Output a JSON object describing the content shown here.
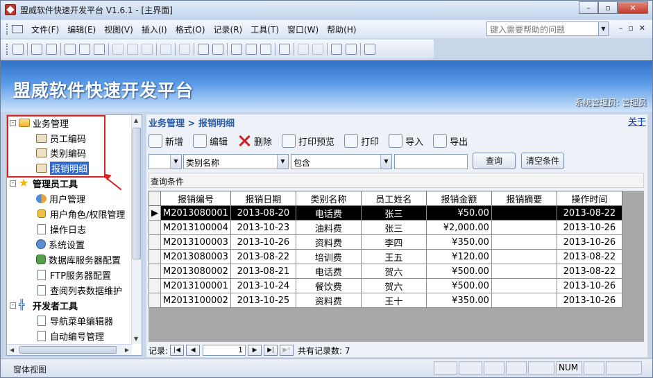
{
  "window": {
    "title": "盟威软件快速开发平台 V1.6.1 - [主界面]",
    "buttons": [
      "–",
      "▫",
      "✕"
    ]
  },
  "menu": {
    "items": [
      "文件(F)",
      "编辑(E)",
      "视图(V)",
      "插入(I)",
      "格式(O)",
      "记录(R)",
      "工具(T)",
      "窗口(W)",
      "帮助(H)"
    ],
    "help_placeholder": "键入需要帮助的问题",
    "mdi_buttons": [
      "–",
      "▫",
      "✕"
    ]
  },
  "banner": {
    "title": "盟威软件快速开发平台",
    "user": "系统管理员: 管理员"
  },
  "tree": {
    "items": [
      {
        "label": "业务管理",
        "expander": "-",
        "icon": "folder"
      },
      {
        "label": "员工编码",
        "icon": "leaf"
      },
      {
        "label": "类别编码",
        "icon": "leaf"
      },
      {
        "label": "报销明细",
        "icon": "leaf",
        "selected": true
      },
      {
        "label": "管理员工具",
        "expander": "-",
        "icon": "star"
      },
      {
        "label": "用户管理",
        "icon": "users"
      },
      {
        "label": "用户角色/权限管理",
        "icon": "lock"
      },
      {
        "label": "操作日志",
        "icon": "doc"
      },
      {
        "label": "系统设置",
        "icon": "gear"
      },
      {
        "label": "数据库服务器配置",
        "icon": "db"
      },
      {
        "label": "FTP服务器配置",
        "icon": "doc"
      },
      {
        "label": "查阅列表数据维护",
        "icon": "doc"
      },
      {
        "label": "开发者工具",
        "expander": "-",
        "icon": "tools"
      },
      {
        "label": "导航菜单编辑器",
        "icon": "doc"
      },
      {
        "label": "自动编号管理",
        "icon": "doc"
      }
    ]
  },
  "main": {
    "breadcrumb": "业务管理 > 报销明细",
    "about": "关于",
    "actions": [
      "新增",
      "编辑",
      "删除",
      "打印预览",
      "打印",
      "导入",
      "导出"
    ],
    "filter": {
      "field": "类别名称",
      "operator": "包含",
      "value": "",
      "query_label": "查询",
      "clear_label": "清空条件"
    },
    "condition_label": "查询条件",
    "columns": [
      "报销编号",
      "报销日期",
      "类别名称",
      "员工姓名",
      "报销金额",
      "报销摘要",
      "操作时间"
    ],
    "rows": [
      [
        "M2013080001",
        "2013-08-20",
        "电话费",
        "张三",
        "¥50.00",
        "",
        "2013-08-22"
      ],
      [
        "M2013100004",
        "2013-10-23",
        "油料费",
        "张三",
        "¥2,000.00",
        "",
        "2013-10-26"
      ],
      [
        "M2013100003",
        "2013-10-26",
        "资料费",
        "李四",
        "¥350.00",
        "",
        "2013-10-26"
      ],
      [
        "M2013080003",
        "2013-08-22",
        "培训费",
        "王五",
        "¥120.00",
        "",
        "2013-08-22"
      ],
      [
        "M2013080002",
        "2013-08-21",
        "电话费",
        "贺六",
        "¥500.00",
        "",
        "2013-08-22"
      ],
      [
        "M2013100001",
        "2013-10-24",
        "餐饮费",
        "贺六",
        "¥500.00",
        "",
        "2013-10-26"
      ],
      [
        "M2013100002",
        "2013-10-25",
        "资料费",
        "王十",
        "¥350.00",
        "",
        "2013-10-26"
      ]
    ],
    "nav": {
      "label": "记录:",
      "current": "1",
      "total_label": "共有记录数: 7"
    }
  },
  "status": {
    "text": "窗体视图",
    "num": "NUM"
  }
}
